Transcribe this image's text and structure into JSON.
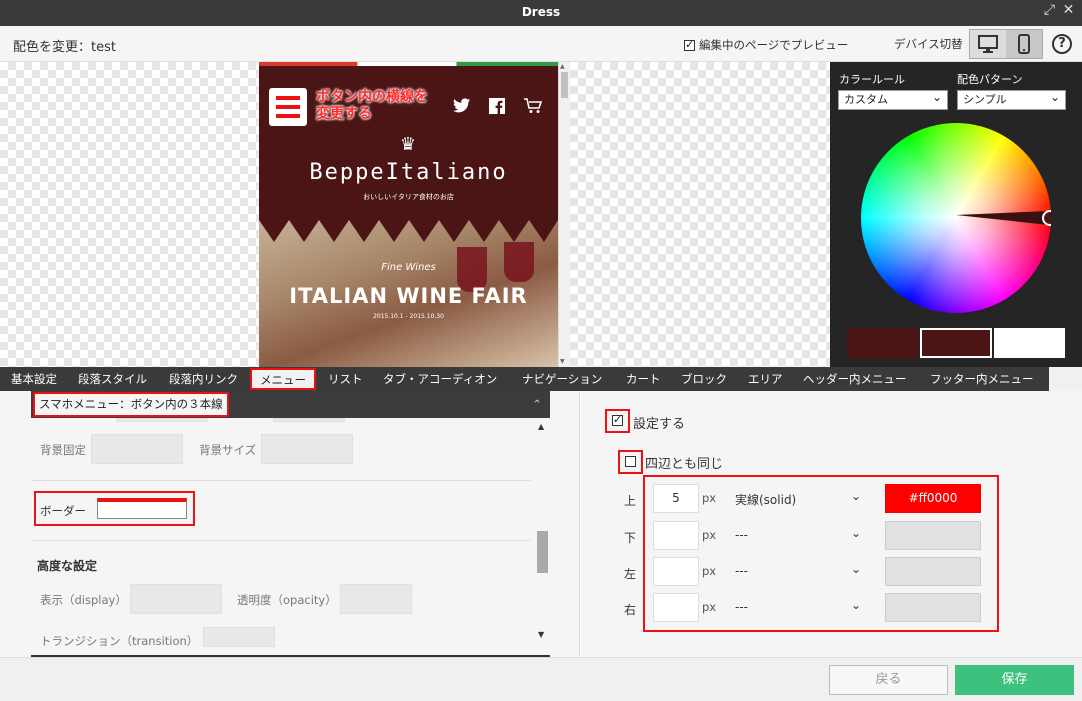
{
  "window": {
    "title": "Dress"
  },
  "topbar": {
    "scheme_label": "配色を変更：test",
    "preview_label": "編集中のページでプレビュー",
    "preview_checked": true,
    "device_label": "デバイス切替",
    "help_symbol": "?"
  },
  "preview": {
    "callout": [
      "ボタン内の横線を",
      "変更する"
    ],
    "brand": "BeppeItaliano",
    "tagline": "おいしいイタリア食材のお店",
    "fine": "Fine Wines",
    "event_title": "ITALIAN WINE FAIR",
    "event_dates": "2015.10.1 - 2015.10.30",
    "social": [
      "twitter-icon",
      "facebook-icon",
      "cart-icon"
    ]
  },
  "color_panel": {
    "rule_label": "カラールール",
    "rule_value": "カスタム",
    "pattern_label": "配色パターン",
    "pattern_value": "シンプル",
    "swatches": [
      "#4a1514",
      "#4a1514",
      "#ffffff"
    ]
  },
  "tabs": [
    "基本設定",
    "段落スタイル",
    "段落内リンク",
    "メニュー",
    "リスト",
    "タブ・アコーディオン",
    "ナビゲーション",
    "カート",
    "ブロック",
    "エリア",
    "ヘッダー内メニュー",
    "フッター内メニュー"
  ],
  "active_tab": "メニュー",
  "left": {
    "section_title": "スマホメニュー：ボタン内の３本線",
    "bg_fixed": "背景固定",
    "bg_size": "背景サイズ",
    "border": "ボーダー",
    "advanced": "高度な設定",
    "display": "表示（display）",
    "opacity": "透明度（opacity）",
    "transition": "トランジション（transition）"
  },
  "right": {
    "enable_label": "設定する",
    "enable_checked": true,
    "same_label": "四辺とも同じ",
    "same_checked": false,
    "unit": "px",
    "rows": [
      {
        "side": "上",
        "width": "5",
        "style": "実線(solid)",
        "color": "#ff0000",
        "color_hex": "#ff0000"
      },
      {
        "side": "下",
        "width": "",
        "style": "---",
        "color": "",
        "color_hex": "#e1e1e1"
      },
      {
        "side": "左",
        "width": "",
        "style": "---",
        "color": "",
        "color_hex": "#e1e1e1"
      },
      {
        "side": "右",
        "width": "",
        "style": "---",
        "color": "",
        "color_hex": "#e1e1e1"
      }
    ]
  },
  "footer": {
    "back": "戻る",
    "save": "保存"
  }
}
